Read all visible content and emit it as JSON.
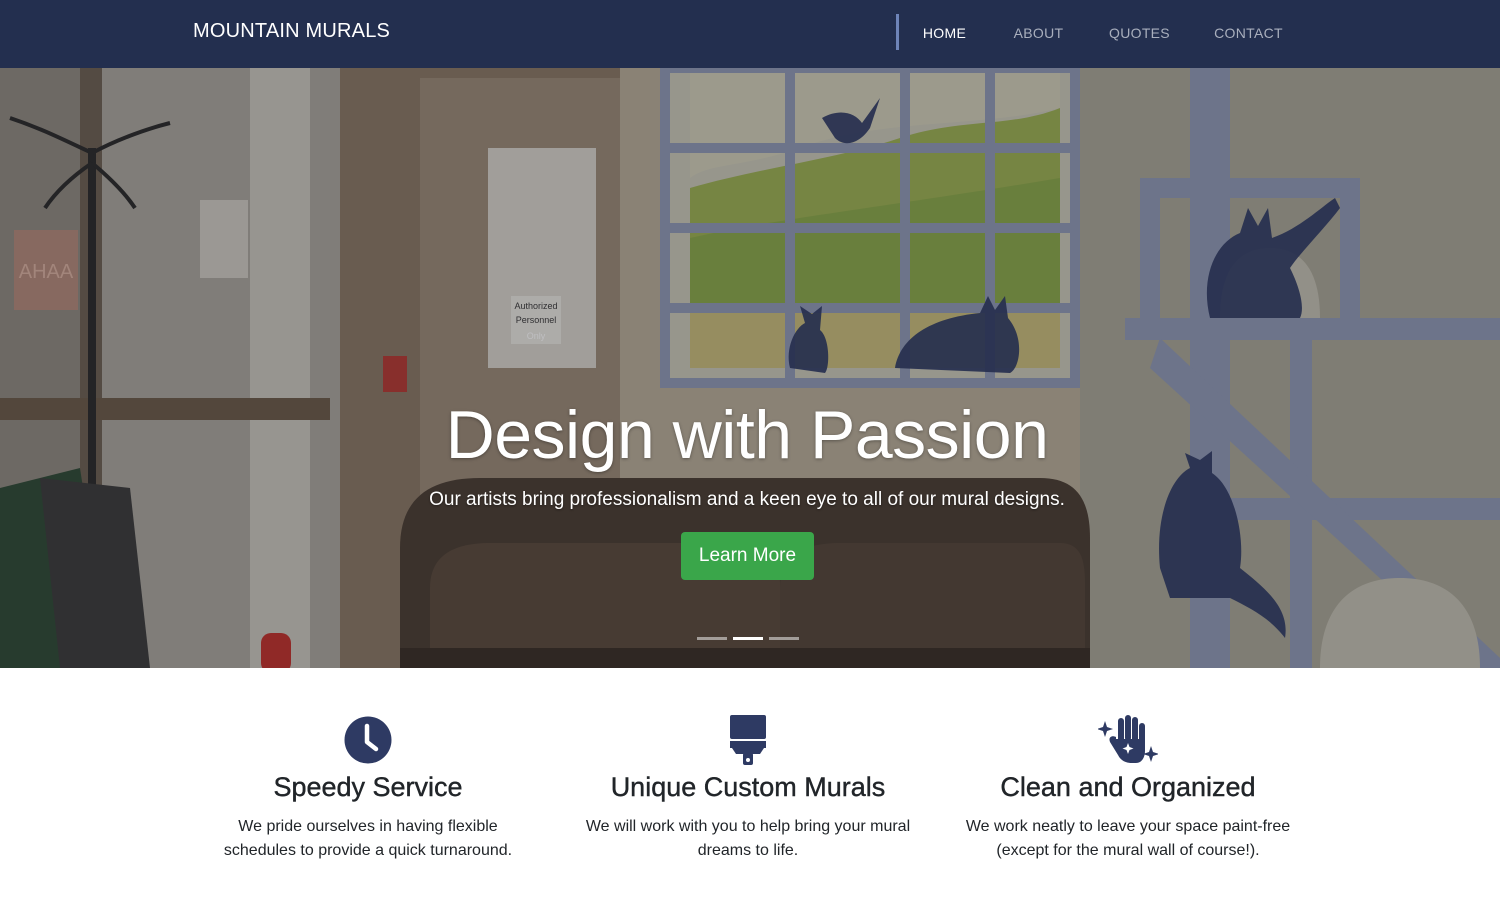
{
  "nav": {
    "brand": "MOUNTAIN MURALS",
    "links": [
      {
        "label": "HOME",
        "active": true
      },
      {
        "label": "ABOUT",
        "active": false
      },
      {
        "label": "QUOTES",
        "active": false
      },
      {
        "label": "CONTACT",
        "active": false
      }
    ]
  },
  "hero": {
    "title": "Design with Passion",
    "subtitle": "Our artists bring professionalism and a keen eye to all of our mural designs.",
    "button_label": "Learn More",
    "slide_count": 3,
    "active_slide": 2,
    "image_text": {
      "sign": "AHAA",
      "door_sign_line1": "Authorized",
      "door_sign_line2": "Personnel",
      "door_sign_line3": "Only"
    }
  },
  "features": [
    {
      "icon": "clock-icon",
      "title": "Speedy Service",
      "text": "We pride ourselves in having flexible schedules to provide a quick turnaround."
    },
    {
      "icon": "paint-brush-icon",
      "title": "Unique Custom Murals",
      "text": "We will work with you to help bring your mural dreams to life."
    },
    {
      "icon": "sparkling-hand-icon",
      "title": "Clean and Organized",
      "text": "We work neatly to leave your space paint-free (except for the mural wall of course!)."
    }
  ],
  "colors": {
    "navbar": "#232f4f",
    "accent_divider": "#6e84b8",
    "button_green": "#3aa64a",
    "icon_navy": "#2e3a63"
  }
}
